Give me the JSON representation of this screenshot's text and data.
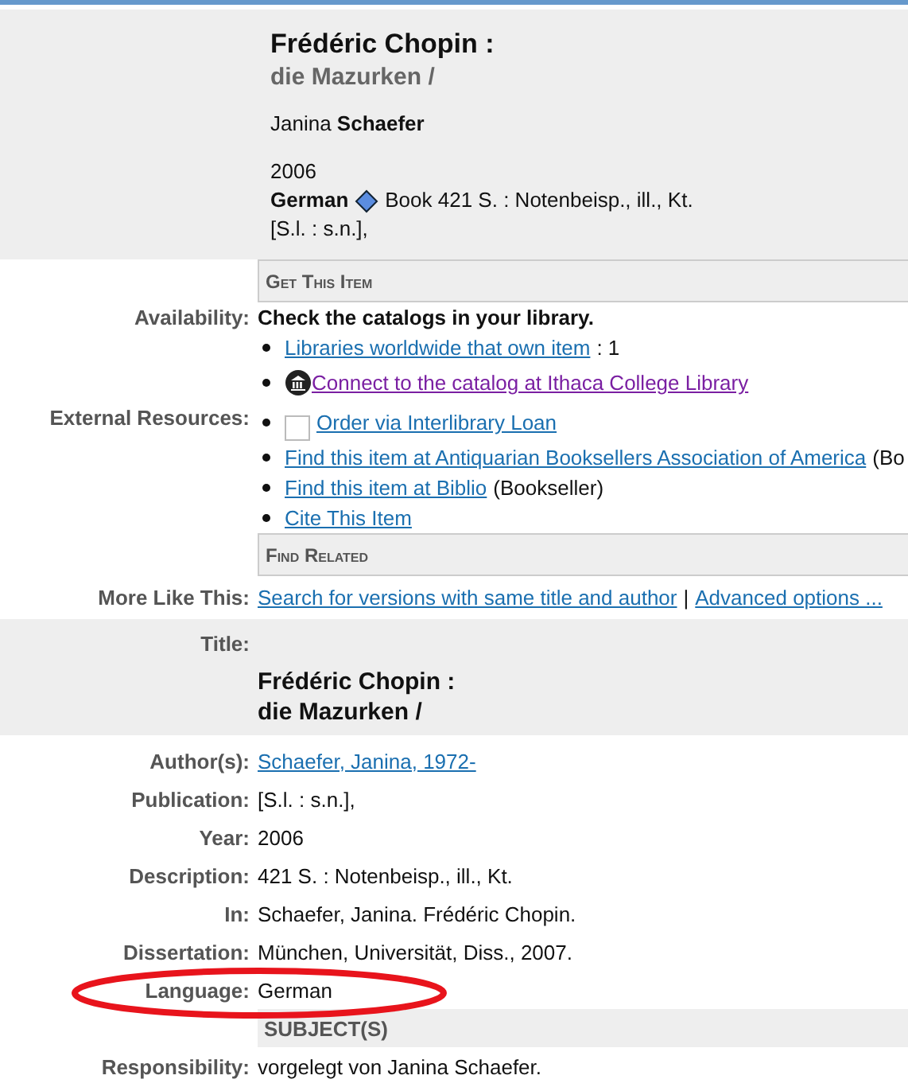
{
  "header": {
    "title": "Frédéric Chopin :",
    "subtitle": "die Mazurken /",
    "author": "Janina **Schaefer**",
    "year": "2006",
    "language": "German",
    "format": "Book 421 S. : Notenbeisp., ill., Kt.",
    "publication": "[S.l. : s.n.],"
  },
  "get_item": {
    "heading": "Get This Item",
    "rows": [
      {
        "label": "Availability:",
        "items": [
          {
            "kind": "heading",
            "text": "Check the catalogs in your library."
          },
          {
            "kind": "link",
            "text": "Libraries worldwide that own item",
            "suffix": ": 1",
            "visited": false
          },
          {
            "kind": "library",
            "text": " Connect to the catalog at Ithaca College Library",
            "visited": true
          }
        ]
      },
      {
        "label": "External Resources:",
        "items": [
          {
            "kind": "loan",
            "text": "Order via Interlibrary Loan",
            "visited": false
          },
          {
            "kind": "link",
            "text": "Find this item at Antiquarian Booksellers Association of America",
            "suffix": " (Bo",
            "visited": false
          },
          {
            "kind": "link",
            "text": "Find this item at Biblio",
            "suffix": " (Bookseller)",
            "visited": false
          },
          {
            "kind": "link",
            "text": "Cite This Item",
            "visited": false
          }
        ]
      }
    ]
  },
  "find_related": {
    "heading": "Find Related",
    "label": "More Like This:",
    "links": [
      "Search for versions with same title and author",
      "Advanced options ..."
    ],
    "separator": "|"
  },
  "details": {
    "title_label": "Title:",
    "title": "Frédéric Chopin :",
    "subtitle": "die Mazurken /",
    "rows": [
      {
        "label": "Author(s):",
        "value": "Schaefer, Janina, 1972-",
        "kind": "link"
      },
      {
        "label": "Publication:",
        "value": "[S.l. : s.n.],",
        "kind": "text"
      },
      {
        "label": "Year:",
        "value": "2006",
        "kind": "text"
      },
      {
        "label": "Description:",
        "value": "421 S. : Notenbeisp., ill., Kt.",
        "kind": "text"
      },
      {
        "label": "In:",
        "value": "Schaefer, Janina. Frédéric Chopin.",
        "kind": "text"
      },
      {
        "label": "Dissertation:",
        "value": "München, Universität, Diss., 2007.",
        "kind": "text"
      },
      {
        "label": "Language:",
        "value": "German",
        "kind": "text"
      }
    ]
  },
  "subjects": {
    "heading": "SUBJECT(S)",
    "label": "Responsibility:",
    "value": "vorgelegt von Janina Schaefer."
  }
}
